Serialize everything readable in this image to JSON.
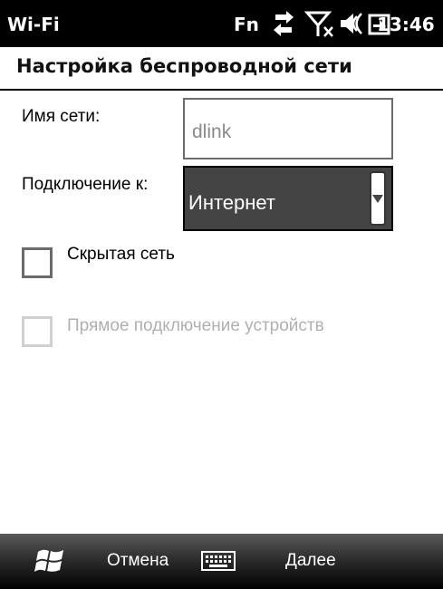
{
  "statusbar": {
    "title": "Wi-Fi",
    "fn": "Fn",
    "time": "13:46",
    "icons": [
      "connectivity-icon",
      "no-signal-icon",
      "volume-icon",
      "battery-charging-icon"
    ]
  },
  "header": {
    "title": "Настройка беспроводной сети"
  },
  "form": {
    "netname_label": "Имя сети:",
    "netname_value": "dlink",
    "connect_label": "Подключение к:",
    "connect_value": "Интернет",
    "hidden_label": "Скрытая сеть",
    "hidden_checked": false,
    "adhoc_label": "Прямое подключение устройств",
    "adhoc_enabled": false
  },
  "bottombar": {
    "left_softkey": "Отмена",
    "right_softkey": "Далее",
    "icons": [
      "windows-start-icon",
      "keyboard-icon"
    ]
  }
}
